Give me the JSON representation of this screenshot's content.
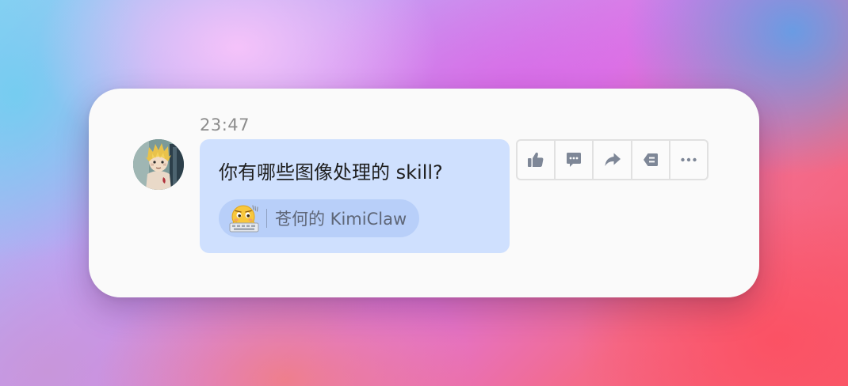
{
  "message": {
    "timestamp": "23:47",
    "text": "你有哪些图像处理的 skill?",
    "attribution": {
      "label": "苍何的 KimiClaw",
      "icon": "typing-face-emoji-icon"
    },
    "sender_avatar": "anime-character-avatar"
  },
  "actions": [
    {
      "name": "like",
      "icon": "thumbs-up-icon"
    },
    {
      "name": "reply-comment",
      "icon": "comment-icon"
    },
    {
      "name": "forward",
      "icon": "forward-arrow-icon"
    },
    {
      "name": "quote",
      "icon": "quote-icon"
    },
    {
      "name": "more",
      "icon": "more-dots-icon"
    }
  ],
  "colors": {
    "bubble": "#cfe0fe",
    "attribution_pill": "#b8cff9",
    "card": "#fafafa",
    "icon": "#7e8797",
    "timestamp": "#8c8c8c"
  }
}
